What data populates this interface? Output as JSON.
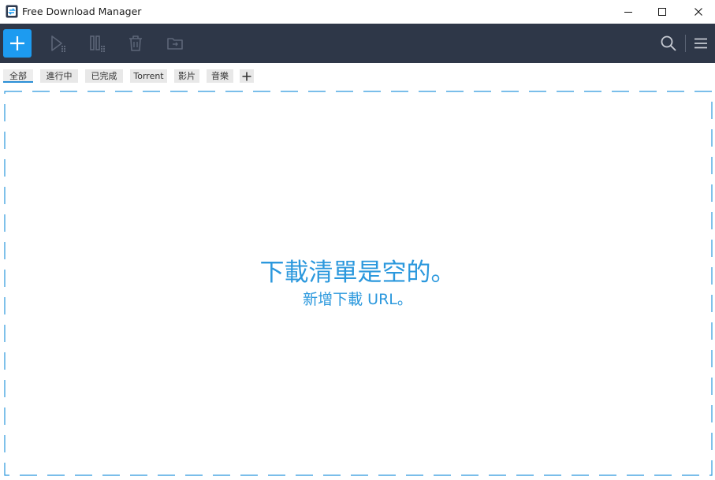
{
  "window": {
    "title": "Free Download Manager",
    "controls": {
      "minimize": "minimize-icon",
      "maximize": "maximize-icon",
      "close": "close-icon"
    }
  },
  "toolbar": {
    "buttons": [
      {
        "name": "add-download-button",
        "icon": "plus-icon"
      },
      {
        "name": "resume-button",
        "icon": "play-icon"
      },
      {
        "name": "pause-button",
        "icon": "pause-icon"
      },
      {
        "name": "delete-button",
        "icon": "trash-icon"
      },
      {
        "name": "move-button",
        "icon": "folder-move-icon"
      },
      {
        "name": "search-button",
        "icon": "search-icon"
      },
      {
        "name": "menu-button",
        "icon": "hamburger-menu-icon"
      }
    ],
    "colors": {
      "background": "#2e3748",
      "accent": "#1d9bf0",
      "icon_disabled": "#5d6678",
      "icon_enabled": "#c8ccd4"
    }
  },
  "tags": [
    {
      "label": "全部",
      "active": true
    },
    {
      "label": "進行中",
      "active": false
    },
    {
      "label": "已完成",
      "active": false
    },
    {
      "label": "Torrent",
      "active": false
    },
    {
      "label": "影片",
      "active": false
    },
    {
      "label": "音樂",
      "active": false
    }
  ],
  "main": {
    "empty_message": "下載清單是空的。",
    "add_url_message": "新增下載 URL。",
    "text_color": "#2b98dd"
  }
}
